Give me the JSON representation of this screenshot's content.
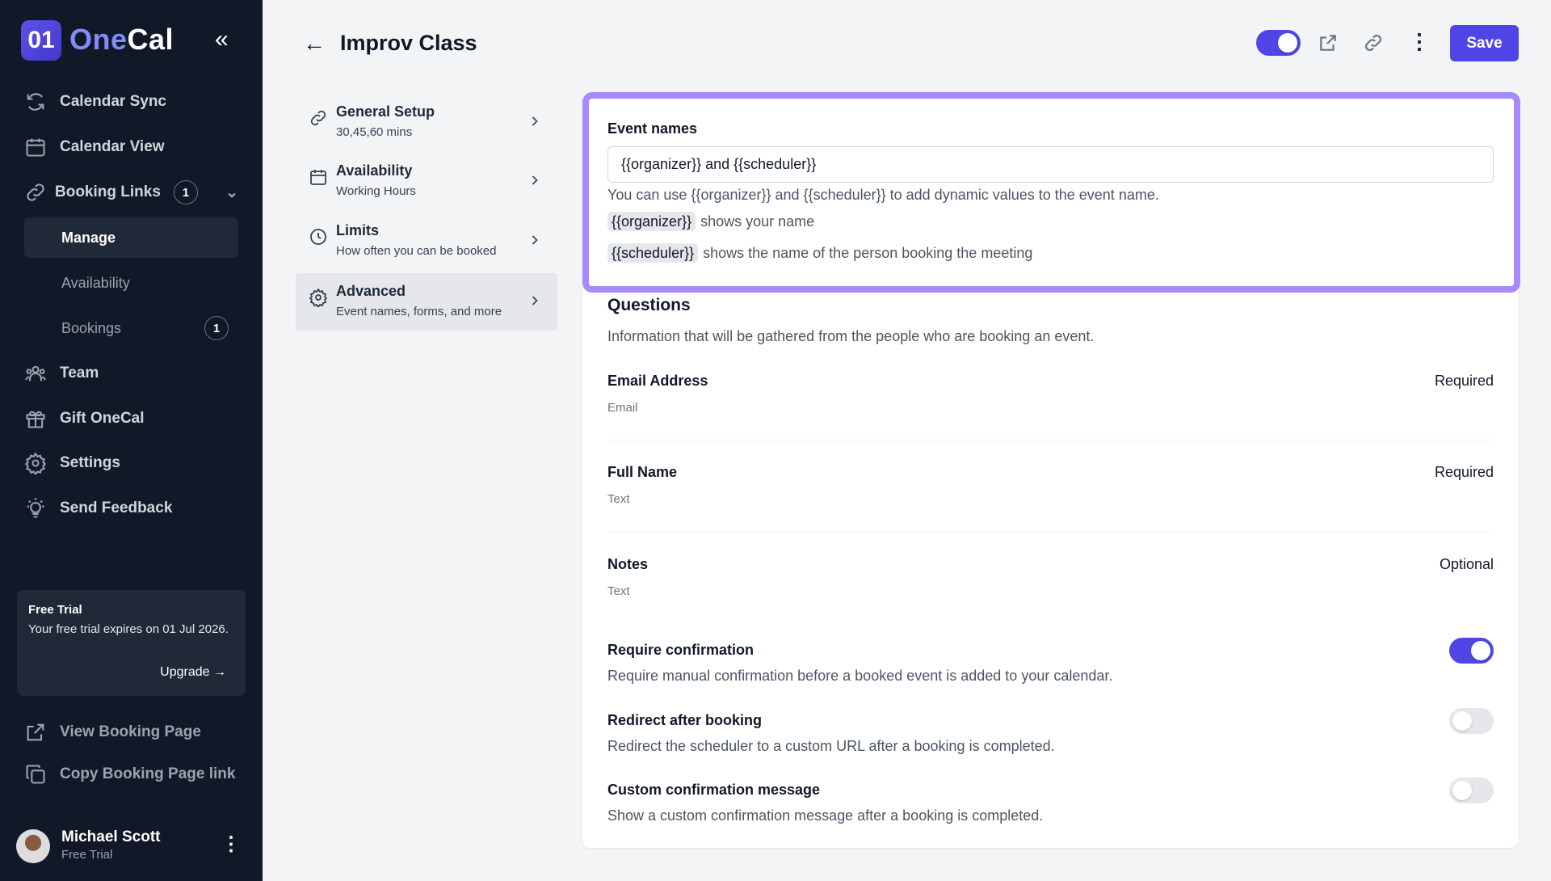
{
  "brand": {
    "logo_mark": "01",
    "name_a": "One",
    "name_b": "Cal"
  },
  "sidebar": {
    "items": [
      {
        "label": "Calendar Sync",
        "icon": "sync-icon"
      },
      {
        "label": "Calendar View",
        "icon": "calendar-icon"
      },
      {
        "label": "Booking Links",
        "icon": "link-icon",
        "badge": "1"
      },
      {
        "label": "Team",
        "icon": "team-icon"
      },
      {
        "label": "Gift OneCal",
        "icon": "gift-icon"
      },
      {
        "label": "Settings",
        "icon": "gear-icon"
      },
      {
        "label": "Send Feedback",
        "icon": "lightbulb-icon"
      }
    ],
    "sub_items": [
      {
        "label": "Manage"
      },
      {
        "label": "Availability"
      },
      {
        "label": "Bookings",
        "badge": "1"
      }
    ],
    "trial": {
      "title": "Free Trial",
      "desc": "Your free trial expires on 01 Jul 2026.",
      "upgrade": "Upgrade →"
    },
    "bottom": [
      {
        "label": "View Booking Page"
      },
      {
        "label": "Copy Booking Page link"
      }
    ],
    "user": {
      "name": "Michael Scott",
      "plan": "Free Trial"
    }
  },
  "header": {
    "title": "Improv Class",
    "save_label": "Save",
    "enabled": true
  },
  "settings_nav": [
    {
      "title": "General Setup",
      "subtitle": "30,45,60 mins"
    },
    {
      "title": "Availability",
      "subtitle": "Working Hours"
    },
    {
      "title": "Limits",
      "subtitle": "How often you can be booked"
    },
    {
      "title": "Advanced",
      "subtitle": "Event names, forms, and more"
    }
  ],
  "event_names": {
    "label": "Event names",
    "value": "{{organizer}} and {{scheduler}}",
    "help": "You can use {{organizer}} and {{scheduler}} to add dynamic values to the event name.",
    "chip1": "{{organizer}}",
    "chip1_desc": "shows your name",
    "chip2": "{{scheduler}}",
    "chip2_desc": "shows the name of the person booking the meeting"
  },
  "questions": {
    "title": "Questions",
    "desc": "Information that will be gathered from the people who are booking an event.",
    "items": [
      {
        "name": "Email Address",
        "type": "Email",
        "status": "Required"
      },
      {
        "name": "Full Name",
        "type": "Text",
        "status": "Required"
      },
      {
        "name": "Notes",
        "type": "Text",
        "status": "Optional"
      }
    ]
  },
  "options": [
    {
      "title": "Require confirmation",
      "desc": "Require manual confirmation before a booked event is added to your calendar.",
      "on": true
    },
    {
      "title": "Redirect after booking",
      "desc": "Redirect the scheduler to a custom URL after a booking is completed.",
      "on": false
    },
    {
      "title": "Custom confirmation message",
      "desc": "Show a custom confirmation message after a booking is completed.",
      "on": false
    }
  ],
  "colors": {
    "accent": "#4f46e5",
    "highlight": "#a78bfa",
    "sidebar": "#111827"
  }
}
